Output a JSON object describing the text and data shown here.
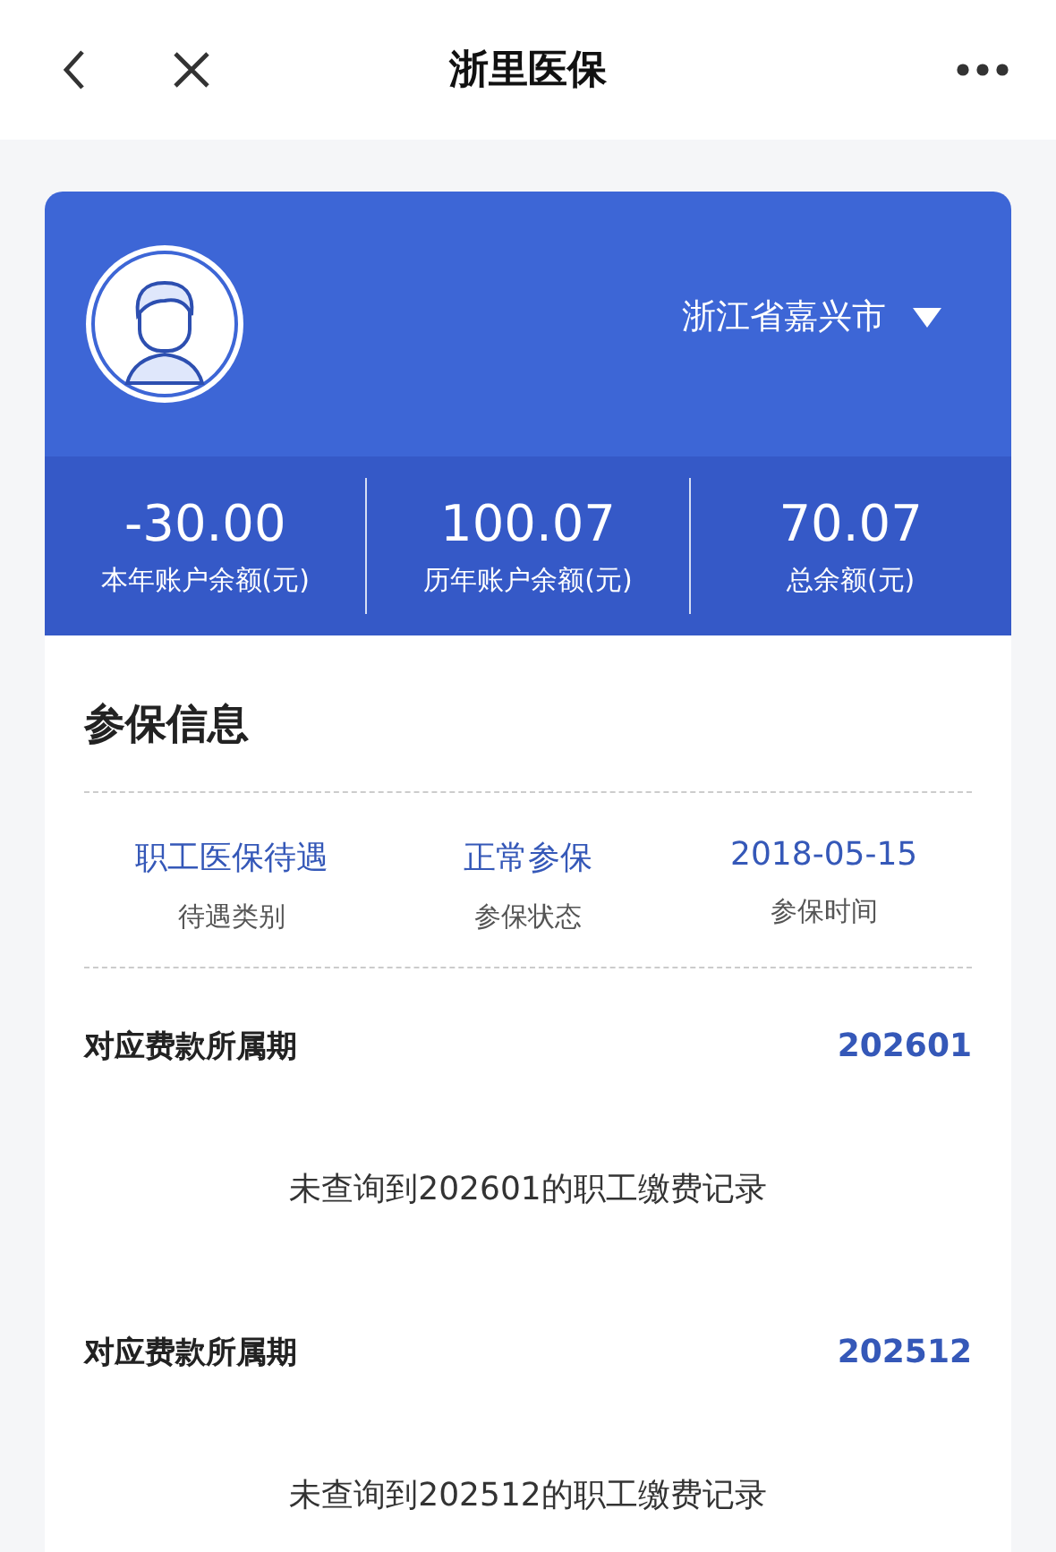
{
  "nav": {
    "title": "浙里医保"
  },
  "account": {
    "region": "浙江省嘉兴市",
    "balances": [
      {
        "amount": "-30.00",
        "label": "本年账户余额(元)"
      },
      {
        "amount": "100.07",
        "label": "历年账户余额(元)"
      },
      {
        "amount": "70.07",
        "label": "总余额(元)"
      }
    ]
  },
  "insurance": {
    "title": "参保信息",
    "facts": [
      {
        "value": "职工医保待遇",
        "label": "待遇类别"
      },
      {
        "value": "正常参保",
        "label": "参保状态"
      },
      {
        "value": "2018-05-15",
        "label": "参保时间"
      }
    ]
  },
  "periods": [
    {
      "label": "对应费款所属期",
      "period": "202601",
      "message": "未查询到202601的职工缴费记录"
    },
    {
      "label": "对应费款所属期",
      "period": "202512",
      "message": "未查询到202512的职工缴费记录"
    }
  ]
}
